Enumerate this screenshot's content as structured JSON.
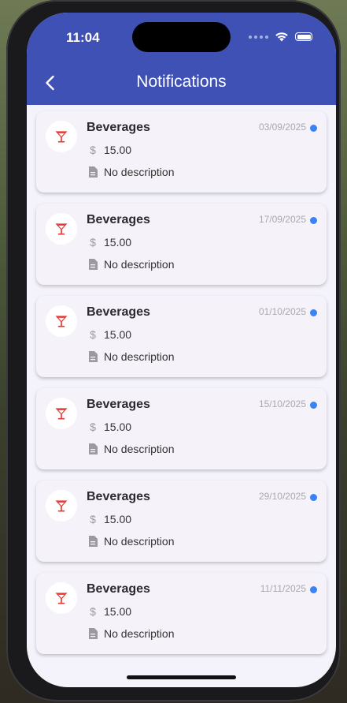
{
  "status_bar": {
    "time": "11:04"
  },
  "header": {
    "title": "Notifications"
  },
  "notifications": [
    {
      "category": "Beverages",
      "date": "03/09/2025",
      "amount": "15.00",
      "description": "No description"
    },
    {
      "category": "Beverages",
      "date": "17/09/2025",
      "amount": "15.00",
      "description": "No description"
    },
    {
      "category": "Beverages",
      "date": "01/10/2025",
      "amount": "15.00",
      "description": "No description"
    },
    {
      "category": "Beverages",
      "date": "15/10/2025",
      "amount": "15.00",
      "description": "No description"
    },
    {
      "category": "Beverages",
      "date": "29/10/2025",
      "amount": "15.00",
      "description": "No description"
    },
    {
      "category": "Beverages",
      "date": "11/11/2025",
      "amount": "15.00",
      "description": "No description"
    }
  ],
  "icons": {
    "back": "chevron-left-icon",
    "category": "cocktail-glass-icon",
    "amount": "dollar-icon",
    "description": "document-icon",
    "unread": "unread-dot"
  },
  "colors": {
    "header_bg": "#3f51b5",
    "category_icon": "#e53935",
    "unread_dot": "#3b82f6",
    "card_bg": "#f5f2fa"
  }
}
